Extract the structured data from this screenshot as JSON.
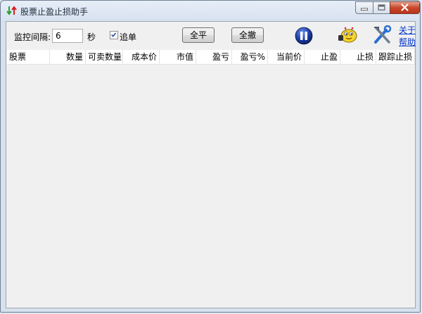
{
  "window": {
    "title": "股票止盈止损助手"
  },
  "toolbar": {
    "interval_label": "监控间隔:",
    "interval_value": "6",
    "interval_unit": "秒",
    "chase_label": "追单",
    "chase_checked": true,
    "close_all_label": "全平",
    "cancel_all_label": "全撤",
    "about_link": "关于",
    "help_link": "帮助"
  },
  "table": {
    "columns": [
      "股票",
      "数量",
      "可卖数量",
      "成本价",
      "市值",
      "盈亏",
      "盈亏%",
      "当前价",
      "止盈",
      "止损",
      "跟踪止损"
    ],
    "rows": []
  },
  "colors": {
    "accent_link": "#0033cc",
    "pause_button": "#1e3ea8"
  }
}
